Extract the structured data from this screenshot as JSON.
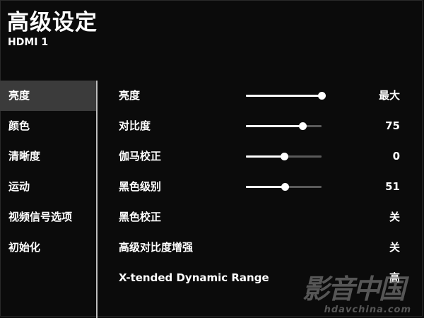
{
  "header": {
    "title": "高级设定",
    "subtitle": "HDMI 1"
  },
  "sidebar": {
    "items": [
      {
        "label": "亮度",
        "active": true
      },
      {
        "label": "颜色",
        "active": false
      },
      {
        "label": "清晰度",
        "active": false
      },
      {
        "label": "运动",
        "active": false
      },
      {
        "label": "视频信号选项",
        "active": false
      },
      {
        "label": "初始化",
        "active": false
      }
    ]
  },
  "settings": [
    {
      "label": "亮度",
      "value": "最大",
      "level": 1.0
    },
    {
      "label": "对比度",
      "value": "75",
      "level": 0.75
    },
    {
      "label": "伽马校正",
      "value": "0",
      "level": 0.5
    },
    {
      "label": "黑色级别",
      "value": "51",
      "level": 0.51
    },
    {
      "label": "黑色校正",
      "value": "关"
    },
    {
      "label": "高级对比度增强",
      "value": "关"
    },
    {
      "label": "X-tended Dynamic Range",
      "value": "高"
    }
  ],
  "watermark": {
    "logo": "影音中国",
    "url": "hdavchina.com"
  },
  "colors": {
    "background": "#0b0b0b",
    "active_item": "#3b3b3b",
    "divider": "#bdbdbd",
    "slider_track": "#5a5a5a",
    "slider_fill": "#ffffff"
  }
}
